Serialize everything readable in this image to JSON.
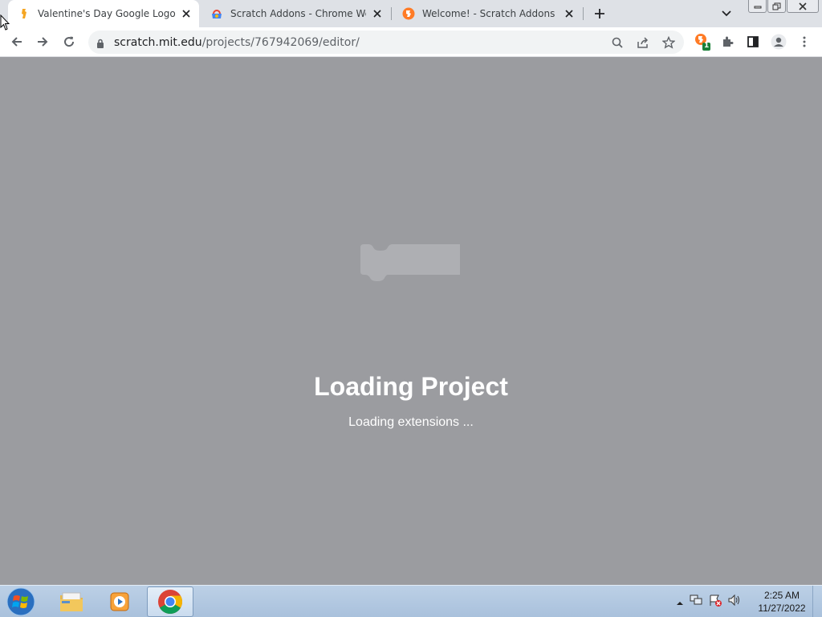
{
  "browser": {
    "tabs": [
      {
        "title": "Valentine's Day Google Logo Sta",
        "active": true,
        "icon": "scratch-addons-orange-icon"
      },
      {
        "title": "Scratch Addons - Chrome Web St",
        "active": false,
        "icon": "chrome-web-store-icon"
      },
      {
        "title": "Welcome! - Scratch Addons",
        "active": false,
        "icon": "scratch-addons-icon"
      }
    ],
    "new_tab_icon": "plus-icon",
    "url_host": "scratch.mit.edu",
    "url_path": "/projects/767942069/editor/",
    "extension_badge": "1",
    "accent": "#1a73e8"
  },
  "page": {
    "background": "#9b9ca0",
    "title": "Loading Project",
    "subtitle": "Loading extensions ..."
  },
  "taskbar": {
    "time": "2:25 AM",
    "date": "11/27/2022",
    "apps": [
      "windows-explorer",
      "media-player",
      "google-chrome"
    ]
  }
}
